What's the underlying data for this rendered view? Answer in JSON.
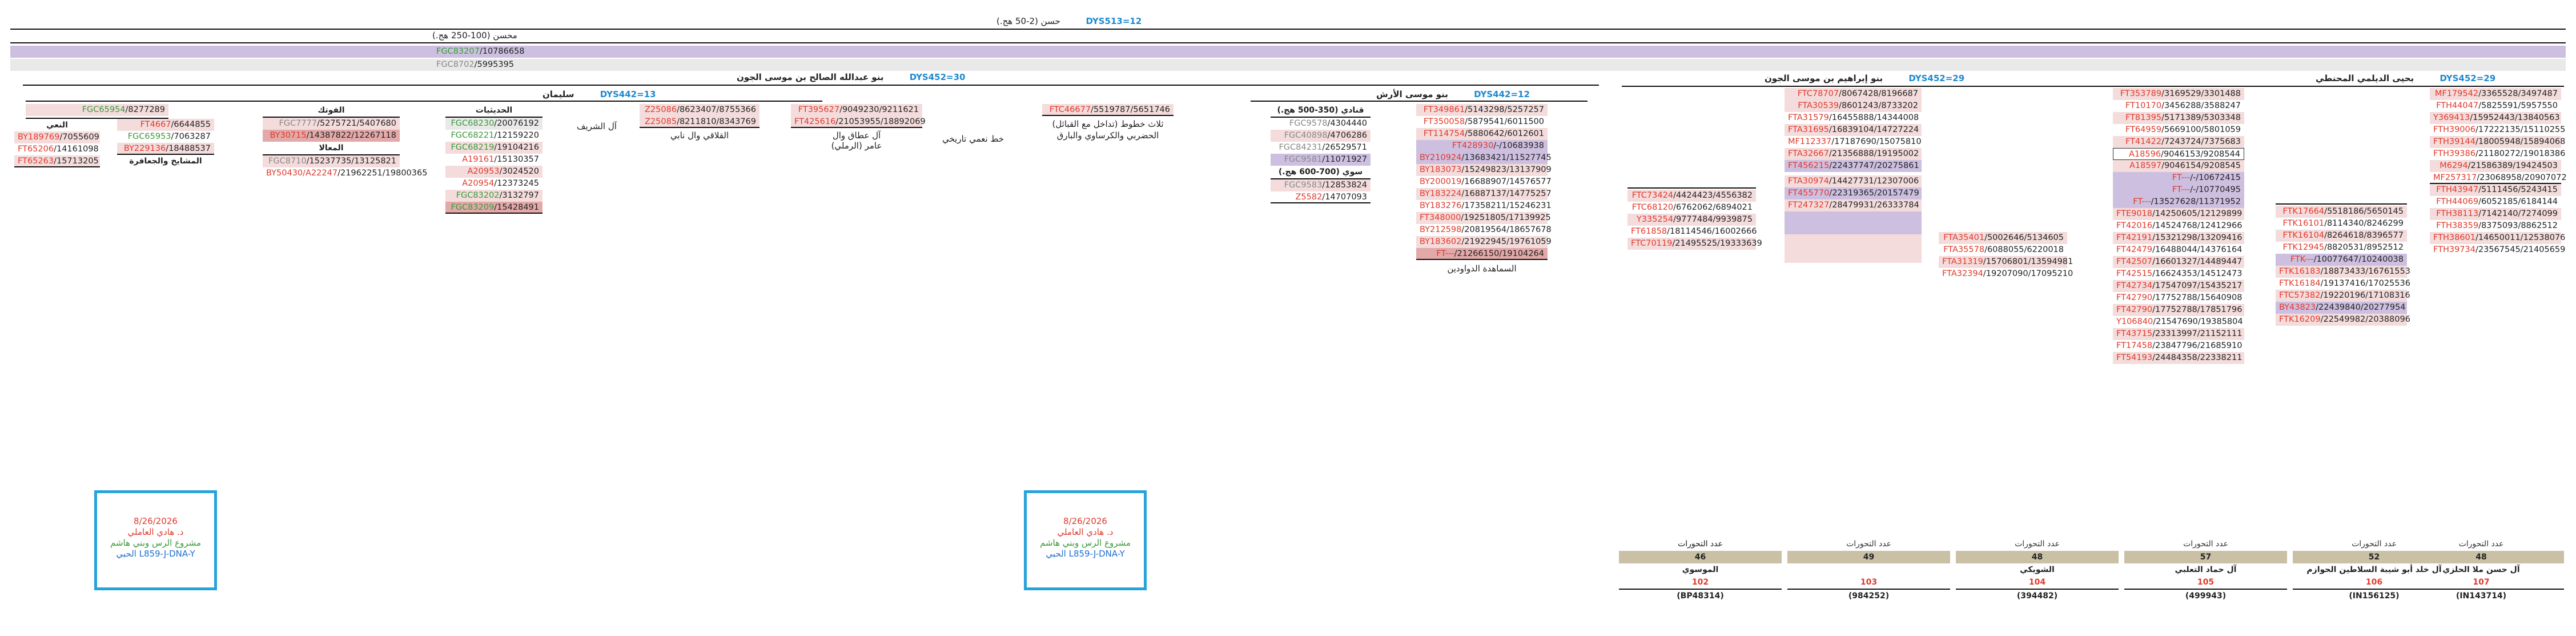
{
  "header": {
    "root_label": "حسن (2-50 هج.)",
    "root_tag": "DYS513=12",
    "level2_label": "محسن (100-250 هج.)",
    "band_rows": [
      {
        "hap": "FGC83207",
        "num": "10786658"
      },
      {
        "hap": "FGC8702",
        "num": "5995395"
      }
    ]
  },
  "branches": [
    {
      "title": "بنو عبدالله الصالح بن موسى الجون",
      "tag": "DYS452=30"
    },
    {
      "title": "بنو موسى الأرش",
      "tag": "DYS442=12"
    },
    {
      "title": "بنو إبراهيم بن موسى الجون",
      "tag": "DYS452=29"
    },
    {
      "title": "بحيى الديلمي المحنطي",
      "tag": "DYS452=29"
    },
    {
      "title": "سليمان",
      "tag": "DYS442=13"
    }
  ],
  "groups": {
    "a_top": {
      "rows": [
        {
          "hap": "FGC65954",
          "num": "8277289"
        }
      ]
    },
    "a1": {
      "label": "النعي",
      "rows": [
        {
          "hap": "BY189769",
          "num": "7055609"
        },
        {
          "hap": "FT65206",
          "num": "14161098"
        },
        {
          "hap": "FT65263",
          "num": "15713205"
        }
      ]
    },
    "a2": {
      "label": "المشايخ والجعافرة",
      "rows": [
        {
          "hap": "FT4667",
          "num": "6644855"
        },
        {
          "hap": "FGC65953",
          "num": "7063287"
        },
        {
          "hap": "BY229136",
          "num": "18488537"
        }
      ]
    },
    "b": {
      "label": "الفوتك",
      "rows": [
        {
          "hap": "FGC7777",
          "num": "5275721/5407680"
        },
        {
          "hap": "BY30715",
          "num": "14387822/12267118"
        }
      ]
    },
    "b2": {
      "label": "المعالا",
      "rows": [
        {
          "hap": "FGC8710",
          "num": "15237735/13125821"
        },
        {
          "hap": "BY50430/A22247",
          "num": "21962251/19800365"
        }
      ]
    },
    "c": {
      "label": "الحديثيات",
      "rows": [
        {
          "hap": "FGC68230",
          "num": "20076192"
        },
        {
          "hap": "FGC68221",
          "num": "12159220"
        },
        {
          "hap": "FGC68219",
          "num": "19104216"
        },
        {
          "hap": "A19161",
          "num": "15130357"
        },
        {
          "hap": "A20953",
          "num": "3024520"
        },
        {
          "hap": "A20954",
          "num": "12373245"
        },
        {
          "hap": "FGC83202",
          "num": "3132797"
        },
        {
          "hap": "FGC83209",
          "num": "15428491"
        }
      ]
    },
    "d": {
      "label": "آل الشريف"
    },
    "e": {
      "label": "القلاقي وال نابي",
      "rows": [
        {
          "hap": "Z25086",
          "num": "8623407/8755366"
        },
        {
          "hap": "Z25085",
          "num": "8211810/8343769"
        }
      ]
    },
    "f": {
      "label": "آل عطاق وال عامر (الرملي)",
      "rows": [
        {
          "hap": "FT395627",
          "num": "9049230/9211621"
        },
        {
          "hap": "FT425616",
          "num": "21053955/18892069"
        }
      ]
    },
    "g": {
      "label": "خط نعمي تاريخي"
    },
    "h": {
      "label": "ثلاث خطوط (تداخل مع القبائل) الحضربي والكرساوي والبارق",
      "rows": [
        {
          "hap": "FTC46677",
          "num": "5519787/5651746"
        }
      ]
    },
    "i": {
      "label": "قنادي (350-500 هج.)",
      "rows": [
        {
          "hap": "FGC9578",
          "num": "4304440"
        },
        {
          "hap": "FGC40898",
          "num": "4706286"
        },
        {
          "hap": "FGC84231",
          "num": "26529571"
        },
        {
          "hap": "FGC9581",
          "num": "11071927"
        }
      ]
    },
    "i2": {
      "label": "سوي (700-600 هج.)",
      "rows": [
        {
          "hap": "FGC9583",
          "num": "12853824"
        },
        {
          "hap": "Z5582",
          "num": "14707093"
        }
      ]
    },
    "j": {
      "label": "السماهدة الدواودين",
      "rows": [
        {
          "hap": "FT349861",
          "num": "5143298/5257257"
        },
        {
          "hap": "FT350058",
          "num": "5879541/6011500"
        },
        {
          "hap": "FT114754",
          "num": "5880642/6012601"
        },
        {
          "hap": "FT428930",
          "num": "-/10683938"
        },
        {
          "hap": "BY210924",
          "num": "13683421/11527745"
        },
        {
          "hap": "BY183073",
          "num": "15249823/13137909"
        },
        {
          "hap": "BY200019",
          "num": "16688907/14576577"
        },
        {
          "hap": "BY183224",
          "num": "16887137/14775257"
        },
        {
          "hap": "BY183276",
          "num": "17358211/15246231"
        },
        {
          "hap": "FT348000",
          "num": "19251805/17139925"
        },
        {
          "hap": "BY212598",
          "num": "20819564/18657678"
        },
        {
          "hap": "BY183602",
          "num": "21922945/19761059"
        },
        {
          "hap": "FT---",
          "num": "21266150/19104264"
        }
      ]
    },
    "k": {
      "rows": [
        {
          "hap": "FTC73424",
          "num": "4424423/4556382"
        },
        {
          "hap": "FTC68120",
          "num": "6762062/6894021"
        },
        {
          "hap": "Y335254",
          "num": "9777484/9939875"
        },
        {
          "hap": "FT61858",
          "num": "18114546/16002666"
        },
        {
          "hap": "FTC70119",
          "num": "21495525/19333639"
        }
      ]
    },
    "l": {
      "rows": [
        {
          "hap": "FTC78707",
          "num": "8067428/8196687"
        },
        {
          "hap": "FTA30539",
          "num": "8601243/8733202"
        },
        {
          "hap": "FTA31579",
          "num": "16455888/14344008"
        },
        {
          "hap": "FTA31695",
          "num": "16839104/14727224"
        },
        {
          "hap": "MF112337",
          "num": "17187690/15075810"
        },
        {
          "hap": "FTA32667",
          "num": "21356888/19195002"
        },
        {
          "hap": "FT456215",
          "num": "22437747/20275861"
        },
        {
          "hap": "FTA30974",
          "num": "14427731/12307006"
        },
        {
          "hap": "FT455770",
          "num": "22319365/20157479"
        },
        {
          "hap": "FT247327",
          "num": "28479931/26333784"
        }
      ]
    },
    "m": {
      "rows": [
        {
          "hap": "FTA35401",
          "num": "5002646/5134605"
        },
        {
          "hap": "FTA35578",
          "num": "6088055/6220018"
        },
        {
          "hap": "FTA31319",
          "num": "15706801/13594981"
        },
        {
          "hap": "FTA32394",
          "num": "19207090/17095210"
        }
      ]
    },
    "n": {
      "rows": [
        {
          "hap": "FT353789",
          "num": "3169529/3301488"
        },
        {
          "hap": "FT10170",
          "num": "3456288/3588247"
        },
        {
          "hap": "FT81395",
          "num": "5171389/5303348"
        },
        {
          "hap": "FT64959",
          "num": "5669100/5801059"
        },
        {
          "hap": "FT41422",
          "num": "7243724/7375683"
        },
        {
          "hap": "A18596",
          "num": "9046153/9208544"
        },
        {
          "hap": "A18597",
          "num": "9046154/9208545"
        },
        {
          "hap": "FT---",
          "num": "-/10672415"
        },
        {
          "hap": "FT---",
          "num": "-/10770495"
        },
        {
          "hap": "FT---",
          "num": "13527628/11371952"
        },
        {
          "hap": "FTE9018",
          "num": "14250605/12129899"
        },
        {
          "hap": "FT42016",
          "num": "14524768/12412966"
        },
        {
          "hap": "FT42191",
          "num": "15321298/13209416"
        },
        {
          "hap": "FT42479",
          "num": "16488044/14376164"
        },
        {
          "hap": "FT42507",
          "num": "16601327/14489447"
        },
        {
          "hap": "FT42515",
          "num": "16624353/14512473"
        },
        {
          "hap": "FT42734",
          "num": "17547097/15435217"
        },
        {
          "hap": "FT42790",
          "num": "17752788/15640908"
        },
        {
          "hap": "FT42790",
          "num": "17752788/17851796"
        },
        {
          "hap": "Y106840",
          "num": "21547690/19385804"
        },
        {
          "hap": "FT43715",
          "num": "23313997/21152111"
        },
        {
          "hap": "FT17458",
          "num": "23847796/21685910"
        },
        {
          "hap": "FT54193",
          "num": "24484358/22338211"
        }
      ]
    },
    "o": {
      "rows": [
        {
          "hap": "FTK17664",
          "num": "5518186/5650145"
        },
        {
          "hap": "FTK16101",
          "num": "8114340/8246299"
        },
        {
          "hap": "FTK16104",
          "num": "8264618/8396577"
        },
        {
          "hap": "FTK12945",
          "num": "8820531/8952512"
        },
        {
          "hap": "FTK---",
          "num": "10077647/10240038"
        },
        {
          "hap": "FTK16183",
          "num": "18873433/16761553"
        },
        {
          "hap": "FTK16184",
          "num": "19137416/17025536"
        },
        {
          "hap": "FTC57382",
          "num": "19220196/17108316"
        },
        {
          "hap": "BY43823",
          "num": "22439840/20277954"
        },
        {
          "hap": "FTK16209",
          "num": "22549982/20388096"
        }
      ]
    },
    "p": {
      "rows": [
        {
          "hap": "MF179542",
          "num": "3365528/3497487"
        },
        {
          "hap": "FTH44047",
          "num": "5825591/5957550"
        },
        {
          "hap": "Y369413",
          "num": "15952443/13840563"
        },
        {
          "hap": "FTH39006",
          "num": "17222135/15110255"
        },
        {
          "hap": "FTH39144",
          "num": "18005948/15894068"
        },
        {
          "hap": "FTH39386",
          "num": "21180272/19018386"
        },
        {
          "hap": "M6294",
          "num": "21586389/19424503"
        },
        {
          "hap": "MF257317",
          "num": "23068958/20907072"
        },
        {
          "hap": "FTH43947",
          "num": "5111456/5243415"
        },
        {
          "hap": "FTH44069",
          "num": "6052185/6184144"
        },
        {
          "hap": "FTH38113",
          "num": "7142140/7274099"
        },
        {
          "hap": "FTH38359",
          "num": "8375093/8862512"
        },
        {
          "hap": "FTH38601",
          "num": "14650011/12538076"
        },
        {
          "hap": "FTH39734",
          "num": "23567545/21405659"
        }
      ]
    }
  },
  "stamps": [
    {
      "date": "8/26/2026",
      "name": "د. هادي العاملي",
      "project": "مشروع الرس وبني هاشم",
      "dna": "الحبي L859-J-DNA-Y"
    },
    {
      "date": "8/26/2026",
      "name": "د. هادي العاملي",
      "project": "مشروع الرس وبني هاشم",
      "dna": "الحبي L859-J-DNA-Y"
    }
  ],
  "summary": [
    {
      "header": "عدد التحورات",
      "count": "46",
      "name": "",
      "number": "",
      "snp": ""
    },
    {
      "header": "عدد التحورات",
      "count": "46",
      "name": "الموسوي",
      "number": "102",
      "snp": "(BP48314)"
    },
    {
      "header": "عدد التحورات",
      "count": "49",
      "name": "",
      "number": "103",
      "snp": "(984252)"
    },
    {
      "header": "عدد التحورات",
      "count": "48",
      "name": "الشويكي",
      "number": "104",
      "snp": "(394482)"
    },
    {
      "header": "عدد التحورات",
      "count": "57",
      "name": "آل حماد التعلبي",
      "number": "105",
      "snp": "(499943)"
    },
    {
      "header": "عدد التحورات",
      "count": "52",
      "name": "آل خلد أبو شيبة السلاطين الحوازم",
      "number": "106",
      "snp": "(IN156125)"
    },
    {
      "header": "عدد التحورات",
      "count": "48",
      "name": "آل حسن ملا الحلزي",
      "number": "107",
      "snp": "(IN143714)"
    }
  ],
  "colors": {
    "tag": "#1e88d0",
    "hap_red": "#e0392b",
    "band_lilac": "#cdbfe0",
    "row_pink": "#f4dcdc",
    "stamp_border": "#27a3db",
    "count_bar": "#c9c0a6"
  }
}
